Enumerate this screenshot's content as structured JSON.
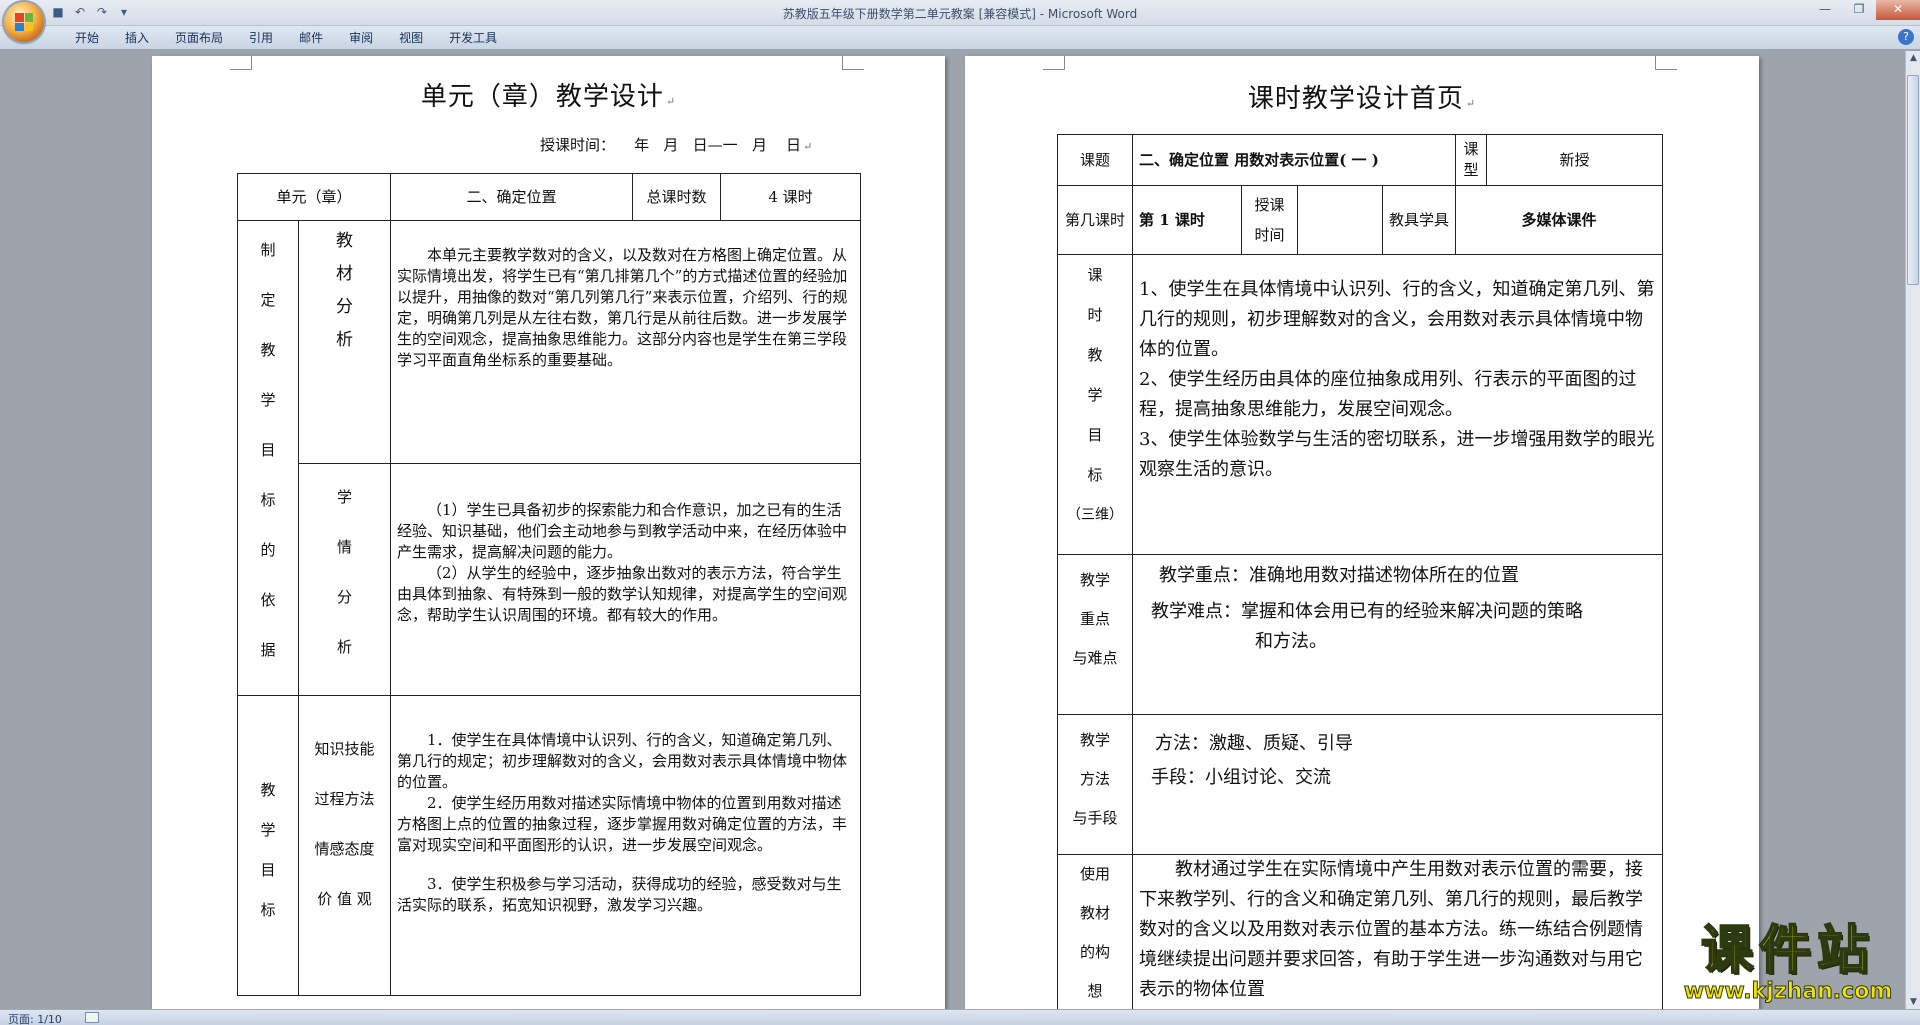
{
  "window": {
    "title": "苏教版五年级下册数学第二单元教案 [兼容模式] - Microsoft Word"
  },
  "ribbon": {
    "tabs": [
      "开始",
      "插入",
      "页面布局",
      "引用",
      "邮件",
      "审阅",
      "视图",
      "开发工具"
    ]
  },
  "status": {
    "page": "页面: 1/10"
  },
  "page1": {
    "title": "单元（章）教学设计",
    "teach_time": "授课时间：    年   月   日—一   月    日",
    "header": {
      "unit_label": "单元（章）",
      "unit_value": "二、确定位置",
      "hours_label": "总课时数",
      "hours_value": "4 课时"
    },
    "basis_label": [
      "制",
      "定",
      "教",
      "学",
      "目",
      "标",
      "的",
      "依",
      "据"
    ],
    "material_label": [
      "教",
      "材",
      "分",
      "析"
    ],
    "material_text": "本单元主要教学数对的含义，以及数对在方格图上确定位置。从实际情境出发，将学生已有“第几排第几个”的方式描述位置的经验加以提升，用抽像的数对“第几列第几行”来表示位置，介绍列、行的规定，明确第几列是从左往右数，第几行是从前往后数。进一步发展学生的空间观念，提高抽象思维能力。这部分内容也是学生在第三学段学习平面直角坐标系的重要基础。",
    "student_label": [
      "学",
      "情",
      "分",
      "析"
    ],
    "student_text_1": "（1）学生已具备初步的探索能力和合作意识，加之已有的生活经验、知识基础，他们会主动地参与到教学活动中来，在经历体验中产生需求，提高解决问题的能力。",
    "student_text_2": "（2）从学生的经验中，逐步抽象出数对的表示方法，符合学生由具体到抽象、有特殊到一般的数学认知规律，对提高学生的空间观念，帮助学生认识周围的环境。都有较大的作用。",
    "goals_label": [
      "教",
      "学",
      "目",
      "标"
    ],
    "goal_types": [
      "知识技能",
      "过程方法",
      "情感态度",
      "价 值 观"
    ],
    "goal_1": "1．使学生在具体情境中认识列、行的含义，知道确定第几列、第几行的规定；初步理解数对的含义，会用数对表示具体情境中物体的位置。",
    "goal_2": "2．使学生经历用数对描述实际情境中物体的位置到用数对描述方格图上点的位置的抽象过程，逐步掌握用数对确定位置的方法，丰富对现实空间和平面图形的认识，进一步发展空间观念。",
    "goal_3": "3．使学生积极参与学习活动，获得成功的经验，感受数对与生活实际的联系，拓宽知识视野，激发学习兴趣。"
  },
  "page2": {
    "title": "课时教学设计首页",
    "topic_label": "课题",
    "topic_value": "二、确定位置   用数对表示位置( 一 )",
    "type_label": "课型",
    "type_value": "新授",
    "period_label": "第几课时",
    "period_value": "第 1 课时",
    "time_label": "授课时间",
    "aids_label": "教具学具",
    "aids_value": "多媒体课件",
    "goals_label": [
      "课",
      "时",
      "教",
      "学",
      "目",
      "标",
      "（三维）"
    ],
    "goal_1": "1、使学生在具体情境中认识列、行的含义，知道确定第几列、第几行的规则，初步理解数对的含义，会用数对表示具体情境中物体的位置。",
    "goal_2": "2、使学生经历由具体的座位抽象成用列、行表示的平面图的过程，提高抽象思维能力，发展空间观念。",
    "goal_3": "3、使学生体验数学与生活的密切联系，进一步增强用数学的眼光观察生活的意识。",
    "key_label": [
      "教学",
      "重点",
      "与难点"
    ],
    "key_point": "教学重点：准确地用数对描述物体所在的位置",
    "difficulty_1": "教学难点：掌握和体会用已有的经验来解决问题的策略",
    "difficulty_2": "和方法。",
    "method_label": [
      "教学",
      "方法",
      "与手段"
    ],
    "method": "方法：激趣、质疑、引导",
    "means": "手段：小组讨论、交流",
    "concept_label": [
      "使用",
      "教材",
      "的构",
      "想"
    ],
    "concept_text": "教材通过学生在实际情境中产生用数对表示位置的需要，接下来教学列、行的含义和确定第几列、第几行的规则，最后教学数对的含义以及用数对表示位置的基本方法。练一练结合例题情境继续提出问题并要求回答，有助于学生进一步沟通数对与用它表示的物体位置"
  },
  "watermark": {
    "line1": "课件站",
    "line2": "www.kjzhan.com"
  }
}
